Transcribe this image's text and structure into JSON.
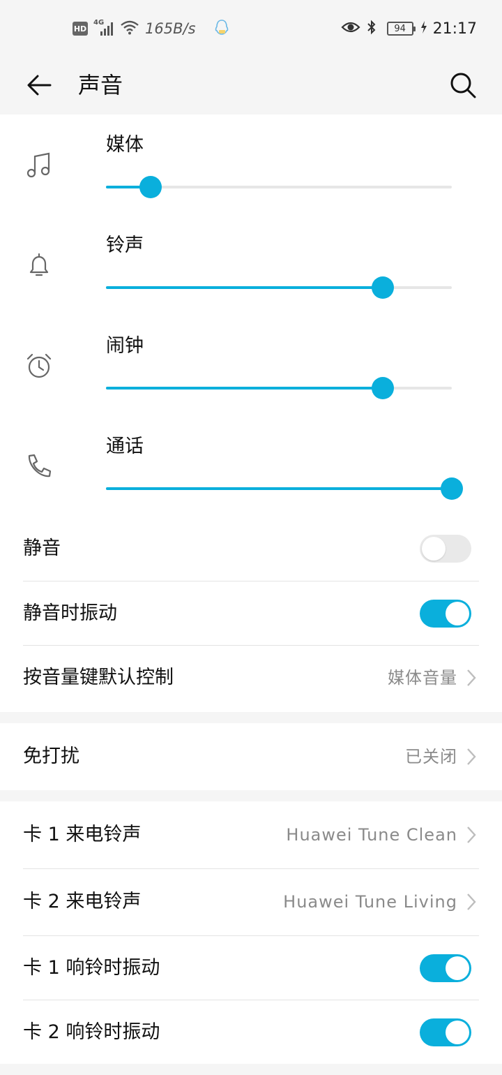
{
  "status_bar": {
    "hd": "HD",
    "network": "4G",
    "net_speed": "165B/s",
    "battery": "94",
    "time": "21:17",
    "icons": [
      "hd-icon",
      "signal-icon",
      "wifi-icon",
      "qq-icon",
      "eye-icon",
      "bluetooth-icon",
      "battery-icon",
      "charging-icon"
    ]
  },
  "app_bar": {
    "title": "声音",
    "back_icon": "back-arrow-icon",
    "search_icon": "search-icon"
  },
  "volume": [
    {
      "label": "媒体",
      "icon": "music-note-icon",
      "level": 0.13
    },
    {
      "label": "铃声",
      "icon": "bell-icon",
      "level": 0.8
    },
    {
      "label": "闹钟",
      "icon": "alarm-clock-icon",
      "level": 0.8
    },
    {
      "label": "通话",
      "icon": "phone-icon",
      "level": 1.0
    }
  ],
  "settings": {
    "mute": {
      "label": "静音",
      "on": false
    },
    "vibrate_silent": {
      "label": "静音时振动",
      "on": true
    },
    "volume_key": {
      "label": "按音量键默认控制",
      "value": "媒体音量"
    },
    "dnd": {
      "label": "免打扰",
      "value": "已关闭"
    },
    "sim1_ringtone": {
      "label": "卡 1 来电铃声",
      "value": "Huawei Tune Clean"
    },
    "sim2_ringtone": {
      "label": "卡 2 来电铃声",
      "value": "Huawei Tune Living"
    },
    "sim1_vibrate": {
      "label": "卡 1 响铃时振动",
      "on": true
    },
    "sim2_vibrate": {
      "label": "卡 2 响铃时振动",
      "on": true
    }
  },
  "colors": {
    "accent": "#0aafdc",
    "background": "#f5f5f5",
    "card": "#ffffff",
    "secondary_text": "#8a8a8a"
  }
}
